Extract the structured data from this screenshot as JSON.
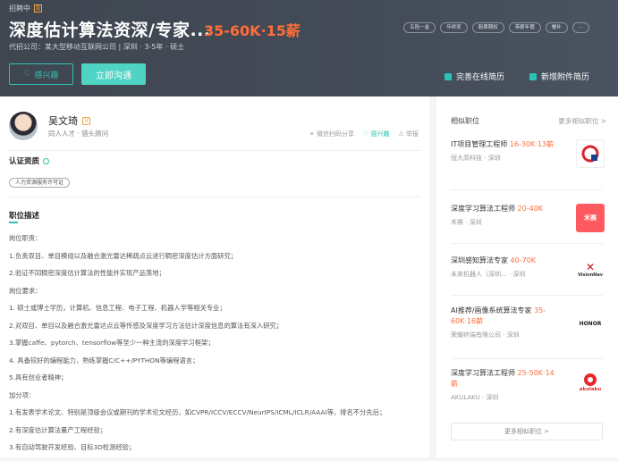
{
  "header": {
    "status": "招聘中",
    "status_badge": "急",
    "title": "深度估计算法资深/专家...",
    "salary": "35-60K·15薪",
    "tags": [
      "五险一金",
      "年终奖",
      "股票期权",
      "带薪年假",
      "餐补",
      "···"
    ],
    "meta": "代招公司：某大型移动互联网公司 | 深圳 · 3-5年 · 硕士",
    "interest_label": "感兴趣",
    "chat_label": "立即沟通",
    "complete_resume": "完善在线简历",
    "attach_resume": "新增附件简历"
  },
  "recruiter": {
    "name": "吴文琦",
    "badge": "V",
    "role": "同人人才 · 猎头顾问",
    "share": "微信扫码分享",
    "interest": "感兴趣",
    "report": "举报"
  },
  "certification": {
    "title": "认证资质",
    "item": "人力资源服务许可证"
  },
  "description": {
    "title": "职位描述",
    "lines": [
      "岗位职责：",
      "1.负责双目、单目模组以及融合激光雷达稀疏点云进行稠密深度估计方面研究；",
      "2.验证不同稠密深度估计算法的性能并实现产品落地；",
      "岗位要求：",
      "1. 硕士或博士学历，计算机、信息工程、电子工程、机器人学等相关专业；",
      "2.对双目、单目以及融合激光雷达点云等传感及深度学习方法估计深度信息的算法有深入研究；",
      "3.掌握caffe、pytorch、tensorflow等至少一种主流的深度学习框架；",
      "4. 具备较好的编程能力，熟练掌握C/C++/PYTHON等编程语言；",
      "5.具有创业者精神；",
      "加分项：",
      "1.有发表学术论文、特别是顶级会议或期刊的学术论文经历，如CVPR/ICCV/ECCV/NeurIPS/ICML/ICLR/AAAI等，排名不分先后；",
      "2.有深度估计算法量产工程经验；",
      "3.有自动驾驶开发经验、目标3D检测经验；"
    ]
  },
  "sidebar": {
    "title": "相似职位",
    "more_link": "更多相似职位 >",
    "jobs": [
      {
        "title": "IT项目管理工程师",
        "salary": "16-30K·13薪",
        "company": "恒大高科技 · 深圳",
        "logo": "恒大",
        "logo_color": "#d8262f"
      },
      {
        "title": "深度学习算法工程师",
        "salary": "20-40K",
        "company": "禾赛 · 深圳",
        "logo": "禾赛",
        "logo_color": "#ff5a5f"
      },
      {
        "title": "深圳感知算法专家",
        "salary": "40-70K",
        "company": "未来机器人（深圳... · 深圳",
        "logo": "VisionNav",
        "logo_color": "#c4161c"
      },
      {
        "title": "AI推荐/画像系统算法专家",
        "salary": "35-60K·16薪",
        "company": "荣耀终端有限公司 · 深圳",
        "logo": "HONOR",
        "logo_color": "#222222"
      },
      {
        "title": "深度学习算法工程师",
        "salary": "25-50K·14薪",
        "company": "AKULAKU · 深圳",
        "logo": "akulaku",
        "logo_color": "#e8262d"
      }
    ],
    "more_button": "更多相似职位 >"
  }
}
